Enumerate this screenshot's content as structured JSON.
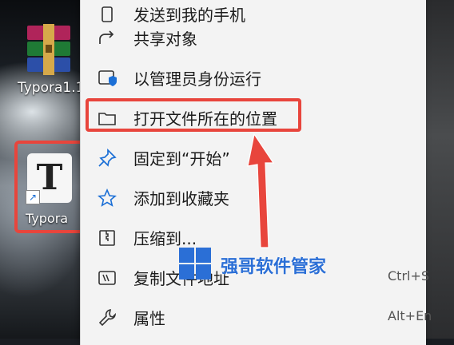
{
  "desktop": {
    "icons": [
      {
        "label": "Typora1.1"
      },
      {
        "label": "Typora",
        "glyph": "T"
      }
    ]
  },
  "context_menu": {
    "items": [
      {
        "label": "发送到我的手机",
        "icon": "phone-send-icon",
        "shortcut": ""
      },
      {
        "label": "共享对象",
        "icon": "share-icon",
        "shortcut": ""
      },
      {
        "label": "以管理员身份运行",
        "icon": "shield-admin-icon",
        "shortcut": ""
      },
      {
        "label": "打开文件所在的位置",
        "icon": "folder-icon",
        "shortcut": ""
      },
      {
        "label": "固定到“开始”",
        "icon": "pin-icon",
        "shortcut": ""
      },
      {
        "label": "添加到收藏夹",
        "icon": "star-icon",
        "shortcut": ""
      },
      {
        "label": "压缩到...",
        "icon": "zip-icon",
        "shortcut": ""
      },
      {
        "label": "复制文件地址",
        "icon": "copy-path-icon",
        "shortcut": "Ctrl+S"
      },
      {
        "label": "属性",
        "icon": "wrench-icon",
        "shortcut": "Alt+En"
      }
    ]
  },
  "watermark": {
    "text": "强哥软件管家"
  },
  "colors": {
    "highlight": "#e8453c",
    "menu_bg": "#f3f3f3",
    "accent": "#2b6fd6"
  }
}
